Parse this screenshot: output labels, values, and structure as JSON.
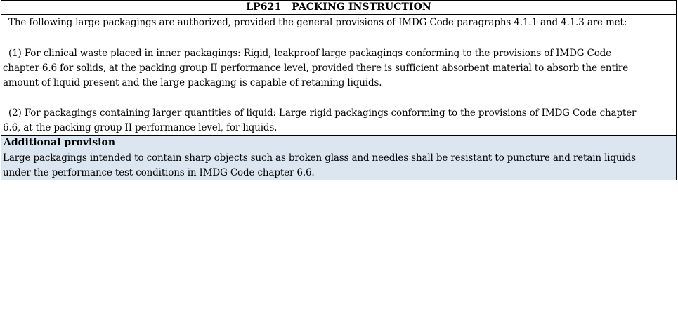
{
  "header": {
    "title": "LP621   PACKING INSTRUCTION"
  },
  "intro": "The following large packagings are authorized, provided the general provisions of IMDG Code paragraphs 4.1.1 and 4.1.3 are met:",
  "provisions": [
    {
      "lines": [
        "(1)  For clinical waste placed in inner packagings: Rigid, leakproof large packagings conforming to the provisions of IMDG Code",
        "chapter 6.6 for solids, at the packing group II performance level, provided there is sufficient absorbent material to absorb the entire",
        "amount of liquid present and the large packaging is capable of retaining liquids."
      ]
    },
    {
      "lines": [
        "(2)  For packagings containing larger quantities of liquid: Large rigid packagings conforming to the provisions of IMDG Code chapter",
        "6.6, at the packing group II performance level, for liquids."
      ]
    }
  ],
  "additional_provision": {
    "title": "Additional provision",
    "lines": [
      "Large packagings intended to contain sharp objects such as broken glass and needles shall be resistant to puncture and retain liquids",
      "under the performance test conditions in IMDG Code chapter 6.6."
    ]
  },
  "colors": {
    "additional_bg": "#dce6f1",
    "border": "#000000"
  }
}
